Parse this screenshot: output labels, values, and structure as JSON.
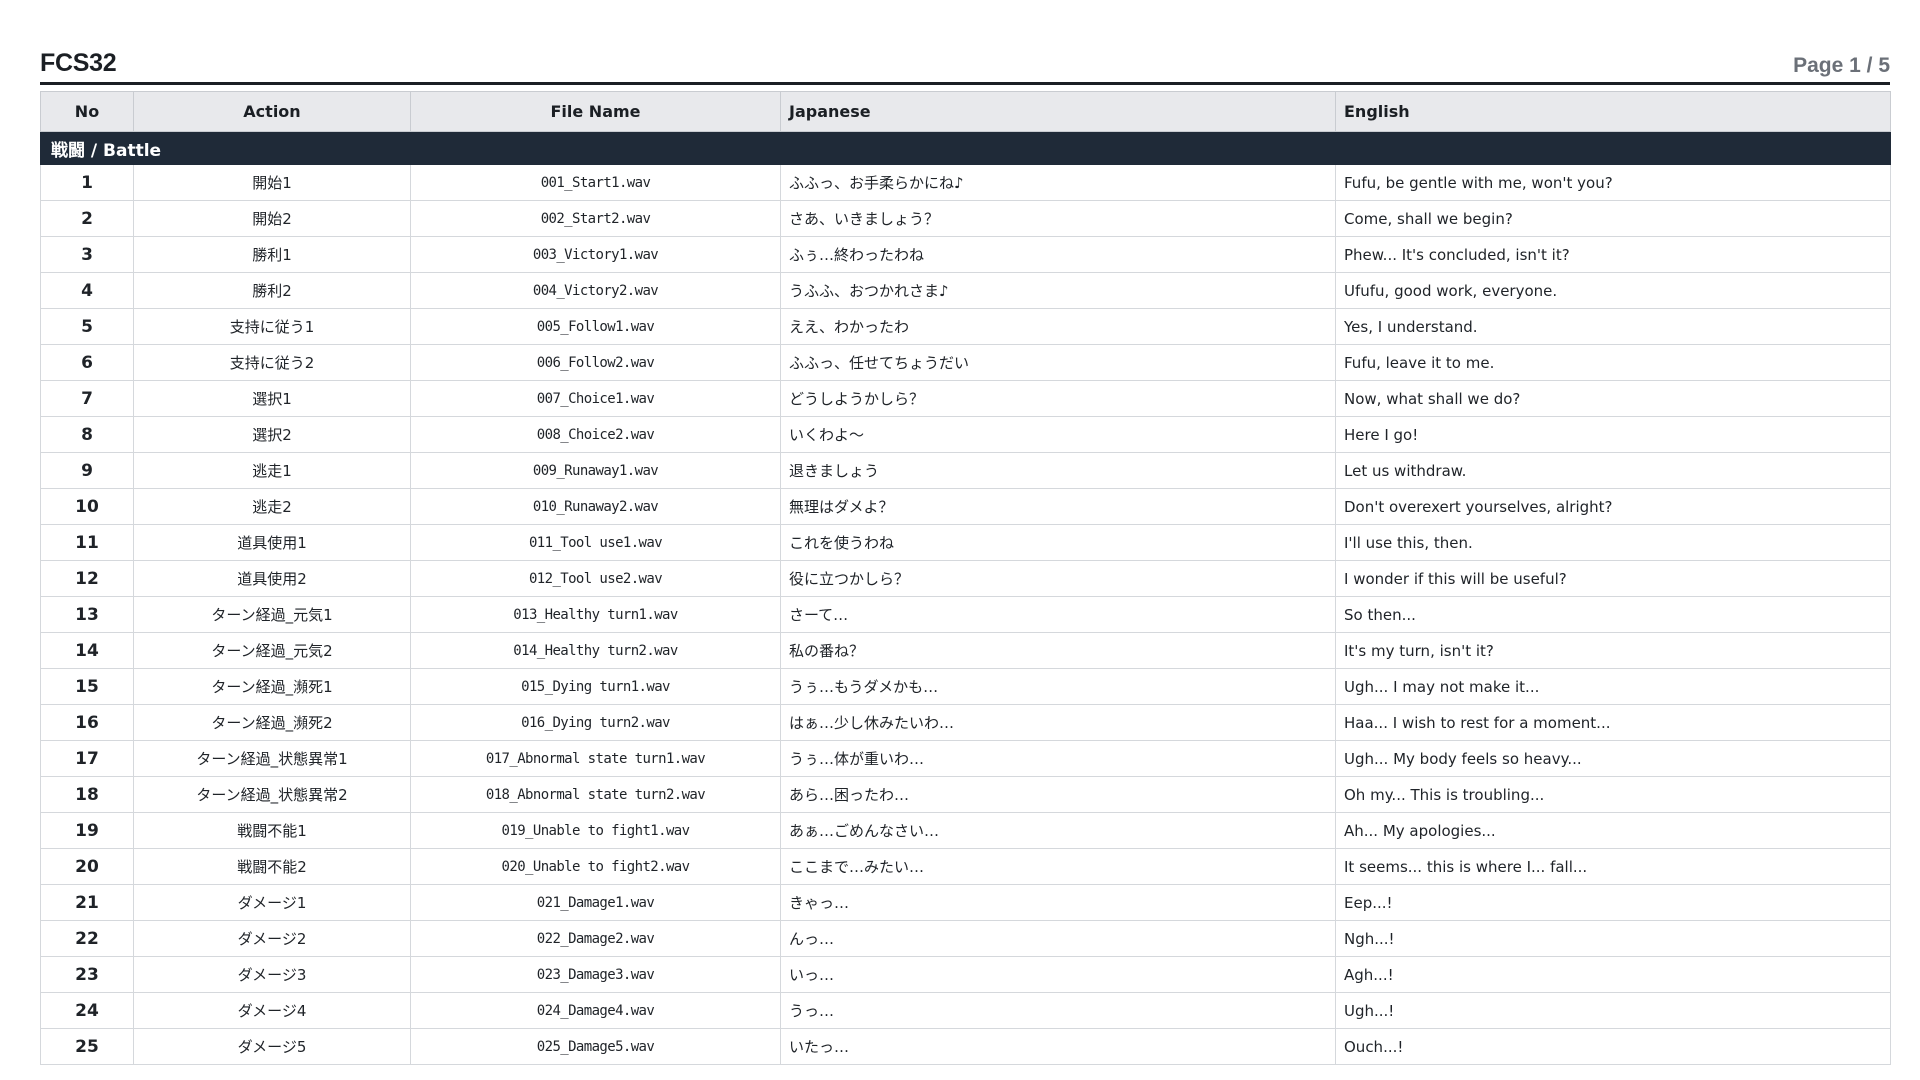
{
  "document": {
    "title": "FCS32",
    "page_indicator": "Page 1 / 5"
  },
  "table": {
    "columns": [
      "No",
      "Action",
      "File Name",
      "Japanese",
      "English"
    ],
    "section_title": "戦闘 / Battle",
    "rows": [
      {
        "no": "1",
        "action": "開始1",
        "file": "001_Start1.wav",
        "jp": "ふふっ、お手柔らかにね♪",
        "en": "Fufu, be gentle with me, won't you?"
      },
      {
        "no": "2",
        "action": "開始2",
        "file": "002_Start2.wav",
        "jp": "さあ、いきましょう？",
        "en": "Come, shall we begin?"
      },
      {
        "no": "3",
        "action": "勝利1",
        "file": "003_Victory1.wav",
        "jp": "ふぅ…終わったわね",
        "en": "Phew... It's concluded, isn't it?"
      },
      {
        "no": "4",
        "action": "勝利2",
        "file": "004_Victory2.wav",
        "jp": "うふふ、おつかれさま♪",
        "en": "Ufufu, good work, everyone."
      },
      {
        "no": "5",
        "action": "支持に従う1",
        "file": "005_Follow1.wav",
        "jp": "ええ、わかったわ",
        "en": "Yes, I understand."
      },
      {
        "no": "6",
        "action": "支持に従う2",
        "file": "006_Follow2.wav",
        "jp": "ふふっ、任せてちょうだい",
        "en": "Fufu, leave it to me."
      },
      {
        "no": "7",
        "action": "選択1",
        "file": "007_Choice1.wav",
        "jp": "どうしようかしら？",
        "en": "Now, what shall we do?"
      },
      {
        "no": "8",
        "action": "選択2",
        "file": "008_Choice2.wav",
        "jp": "いくわよ〜",
        "en": "Here I go!"
      },
      {
        "no": "9",
        "action": "逃走1",
        "file": "009_Runaway1.wav",
        "jp": "退きましょう",
        "en": "Let us withdraw."
      },
      {
        "no": "10",
        "action": "逃走2",
        "file": "010_Runaway2.wav",
        "jp": "無理はダメよ？",
        "en": "Don't overexert yourselves, alright?"
      },
      {
        "no": "11",
        "action": "道具使用1",
        "file": "011_Tool use1.wav",
        "jp": "これを使うわね",
        "en": "I'll use this, then."
      },
      {
        "no": "12",
        "action": "道具使用2",
        "file": "012_Tool use2.wav",
        "jp": "役に立つかしら？",
        "en": "I wonder if this will be useful?"
      },
      {
        "no": "13",
        "action": "ターン経過_元気1",
        "file": "013_Healthy turn1.wav",
        "jp": "さーて…",
        "en": "So then..."
      },
      {
        "no": "14",
        "action": "ターン経過_元気2",
        "file": "014_Healthy turn2.wav",
        "jp": "私の番ね？",
        "en": "It's my turn, isn't it?"
      },
      {
        "no": "15",
        "action": "ターン経過_瀕死1",
        "file": "015_Dying turn1.wav",
        "jp": "うぅ…もうダメかも…",
        "en": "Ugh... I may not make it..."
      },
      {
        "no": "16",
        "action": "ターン経過_瀕死2",
        "file": "016_Dying turn2.wav",
        "jp": "はぁ…少し休みたいわ…",
        "en": "Haa... I wish to rest for a moment..."
      },
      {
        "no": "17",
        "action": "ターン経過_状態異常1",
        "file": "017_Abnormal state turn1.wav",
        "jp": "うぅ…体が重いわ…",
        "en": "Ugh... My body feels so heavy..."
      },
      {
        "no": "18",
        "action": "ターン経過_状態異常2",
        "file": "018_Abnormal state turn2.wav",
        "jp": "あら…困ったわ…",
        "en": "Oh my... This is troubling..."
      },
      {
        "no": "19",
        "action": "戦闘不能1",
        "file": "019_Unable to fight1.wav",
        "jp": "あぁ…ごめんなさい…",
        "en": "Ah... My apologies..."
      },
      {
        "no": "20",
        "action": "戦闘不能2",
        "file": "020_Unable to fight2.wav",
        "jp": "ここまで…みたい…",
        "en": "It seems... this is where I... fall..."
      },
      {
        "no": "21",
        "action": "ダメージ1",
        "file": "021_Damage1.wav",
        "jp": "きゃっ…",
        "en": "Eep...!"
      },
      {
        "no": "22",
        "action": "ダメージ2",
        "file": "022_Damage2.wav",
        "jp": "んっ…",
        "en": "Ngh...!"
      },
      {
        "no": "23",
        "action": "ダメージ3",
        "file": "023_Damage3.wav",
        "jp": "いっ…",
        "en": "Agh...!"
      },
      {
        "no": "24",
        "action": "ダメージ4",
        "file": "024_Damage4.wav",
        "jp": "うっ…",
        "en": "Ugh...!"
      },
      {
        "no": "25",
        "action": "ダメージ5",
        "file": "025_Damage5.wav",
        "jp": "いたっ…",
        "en": "Ouch...!"
      }
    ]
  },
  "colors": {
    "section_bg": "#1f2a38",
    "header_bg": "#e8e9ec",
    "title_rule": "#1b1f24",
    "page_indicator": "#6b7078"
  }
}
